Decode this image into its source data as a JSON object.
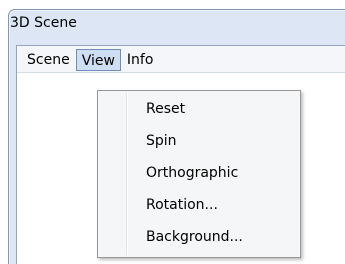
{
  "window": {
    "title": "3D Scene"
  },
  "menubar": {
    "items": [
      "Scene",
      "View",
      "Info"
    ],
    "active": "View"
  },
  "dropdown": {
    "items": [
      "Reset",
      "Spin",
      "Orthographic",
      "Rotation...",
      "Background..."
    ]
  }
}
